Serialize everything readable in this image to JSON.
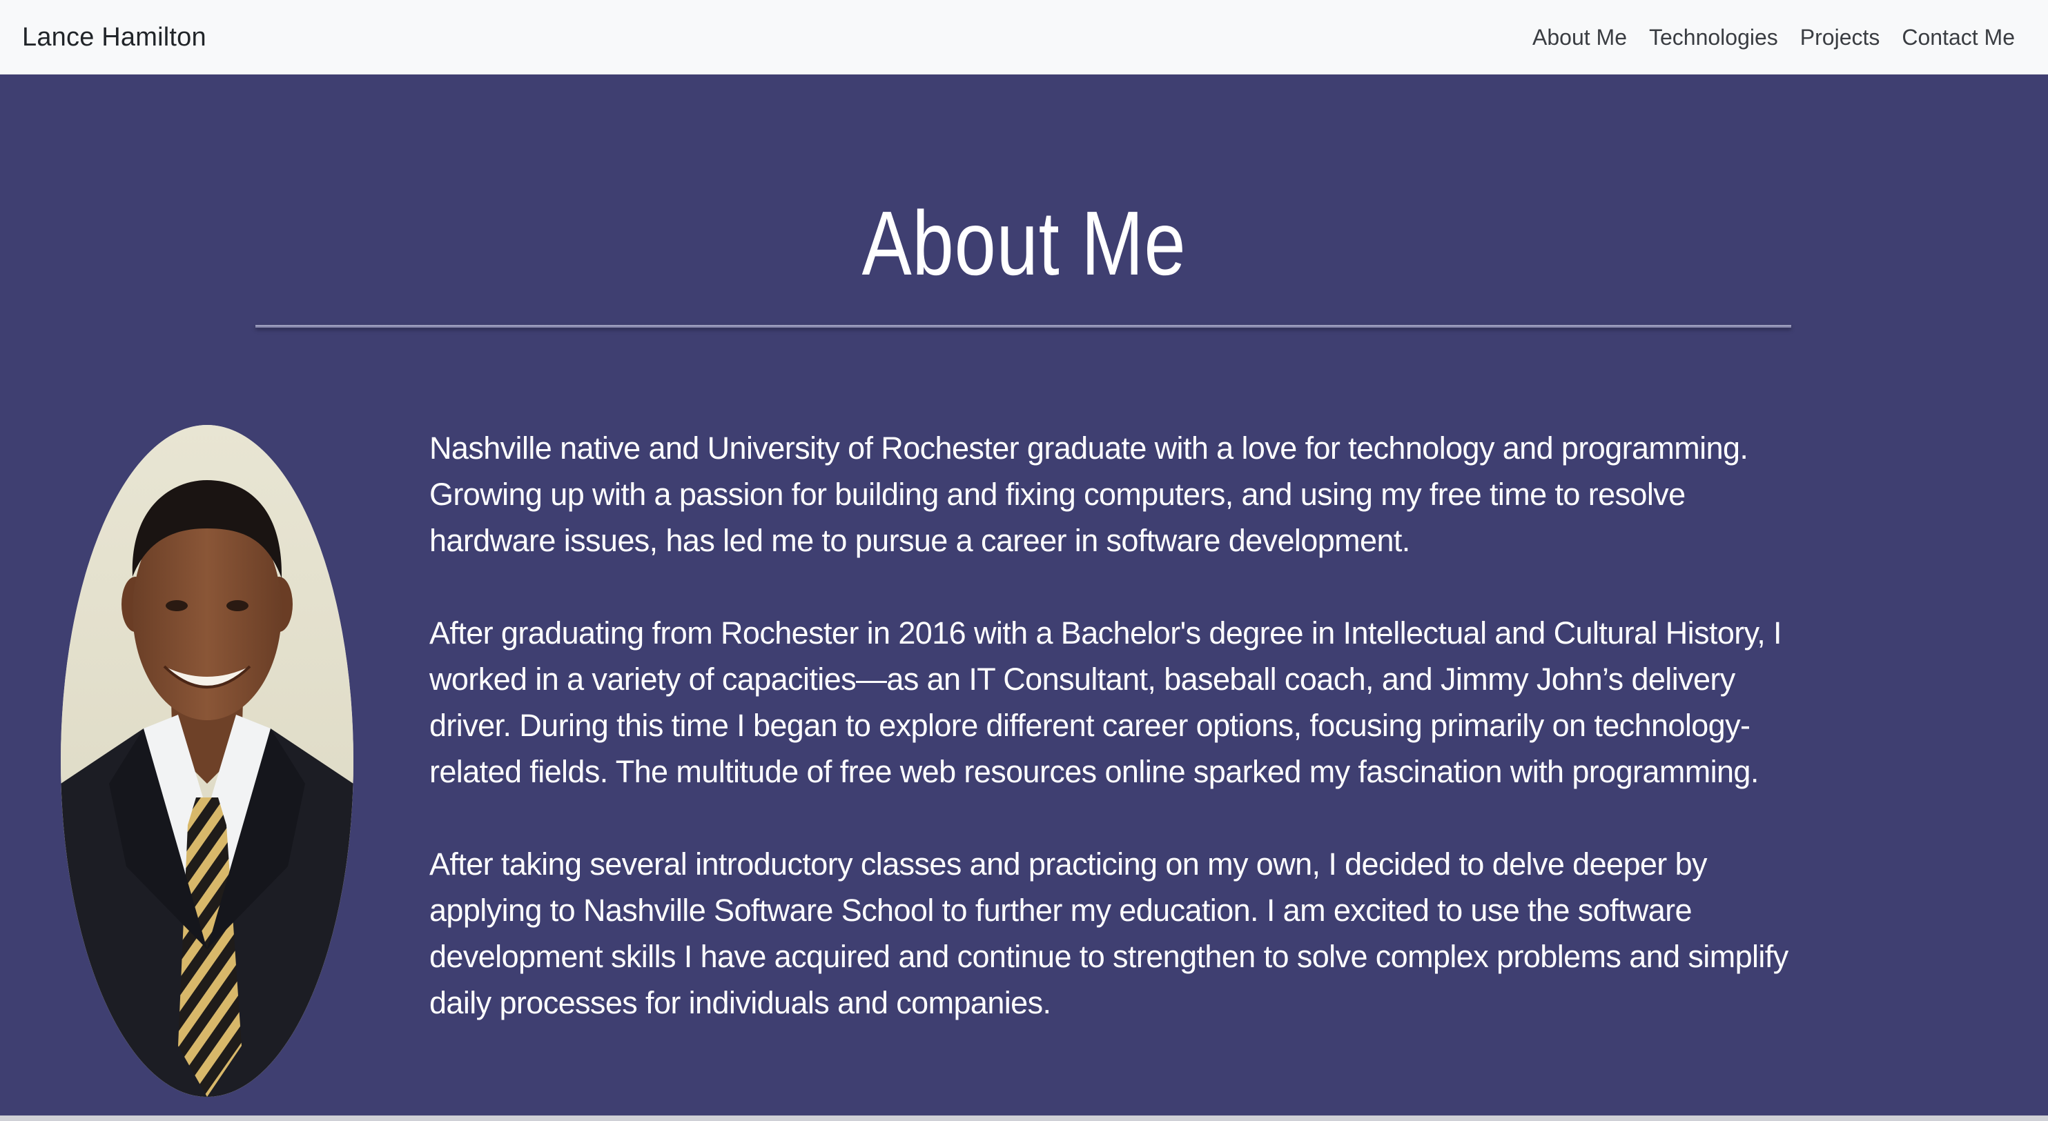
{
  "navbar": {
    "brand": "Lance Hamilton",
    "links": [
      {
        "label": "About Me"
      },
      {
        "label": "Technologies"
      },
      {
        "label": "Projects"
      },
      {
        "label": "Contact Me"
      }
    ]
  },
  "about": {
    "title": "About Me",
    "paragraphs": [
      "Nashville native and University of Rochester graduate with a love for technology and programming. Growing up with a passion for building and fixing computers, and using my free time to resolve hardware issues, has led me to pursue a career in software development.",
      "After graduating from Rochester in 2016 with a Bachelor's degree in Intellectual and Cultural History, I worked in a variety of capacities—as an IT Consultant, baseball coach, and Jimmy John’s delivery driver. During this time I began to explore different career options, focusing primarily on technology-related fields. The multitude of free web resources online sparked my fascination with programming.",
      "After taking several introductory classes and practicing on my own, I decided to delve deeper by applying to Nashville Software School to further my education. I am excited to use the software development skills I have acquired and continue to strengthen to solve complex problems and simplify daily processes for individuals and companies."
    ]
  },
  "colors": {
    "navbar_bg": "#f8f9fa",
    "section_bg": "#3f3f71",
    "text_light": "#ffffff"
  }
}
